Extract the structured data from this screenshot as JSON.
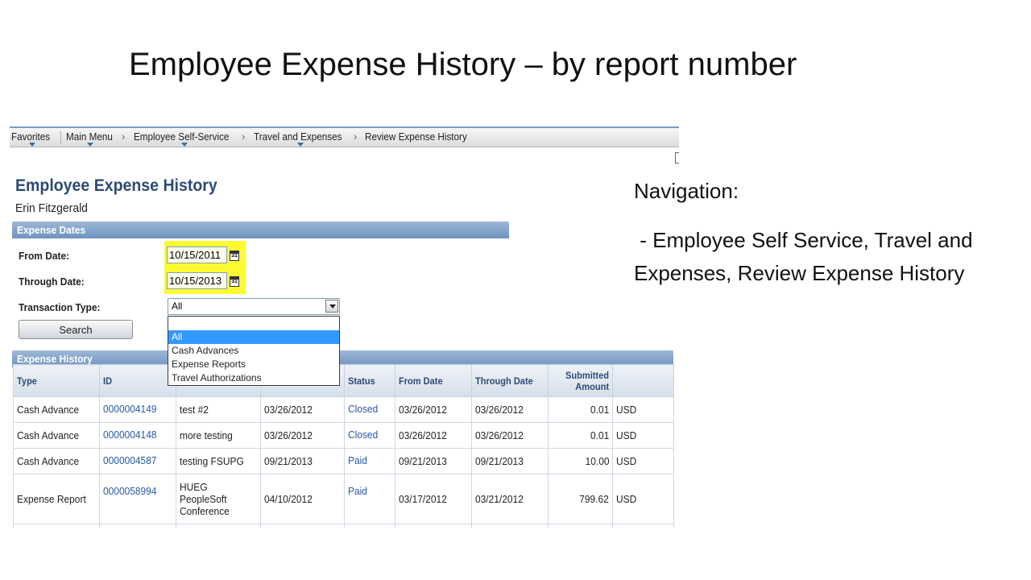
{
  "slide": {
    "title": "Employee Expense History – by report number",
    "navigation_heading": "Navigation:",
    "navigation_text": " - Employee Self Service, Travel and Expenses, Review Expense History"
  },
  "breadcrumb": {
    "items": [
      "Favorites",
      "Main Menu",
      "Employee Self-Service",
      "Travel and Expenses",
      "Review Expense History"
    ]
  },
  "page": {
    "title": "Employee Expense History",
    "employee_name": "Erin Fitzgerald"
  },
  "expense_dates": {
    "header": "Expense Dates",
    "from_label": "From Date:",
    "from_value": "10/15/2011",
    "through_label": "Through Date:",
    "through_value": "10/15/2013",
    "type_label": "Transaction Type:",
    "type_value": "All",
    "type_options": [
      "All",
      "Cash Advances",
      "Expense Reports",
      "Travel Authorizations"
    ],
    "search_label": "Search"
  },
  "expense_history": {
    "header": "Expense History",
    "columns": [
      "Type",
      "ID",
      "",
      "",
      "Status",
      "From Date",
      "Through Date",
      "Submitted Amount",
      ""
    ],
    "rows": [
      {
        "type": "Cash Advance",
        "id": "0000004149",
        "description": "test #2",
        "date": "03/26/2012",
        "status": "Closed",
        "from": "03/26/2012",
        "through": "03/26/2012",
        "amount": "0.01",
        "currency": "USD"
      },
      {
        "type": "Cash Advance",
        "id": "0000004148",
        "description": "more testing",
        "date": "03/26/2012",
        "status": "Closed",
        "from": "03/26/2012",
        "through": "03/26/2012",
        "amount": "0.01",
        "currency": "USD"
      },
      {
        "type": "Cash Advance",
        "id": "0000004587",
        "description": "testing FSUPG",
        "date": "09/21/2013",
        "status": "Paid",
        "from": "09/21/2013",
        "through": "09/21/2013",
        "amount": "10.00",
        "currency": "USD"
      },
      {
        "type": "Expense Report",
        "id": "0000058994",
        "description_lines": [
          "HUEG",
          "PeopleSoft",
          "Conference"
        ],
        "date": "04/10/2012",
        "status": "Paid",
        "from": "03/17/2012",
        "through": "03/21/2012",
        "amount": "799.62",
        "currency": "USD"
      }
    ]
  },
  "colors": {
    "section_header": "#7a9bc6",
    "highlight": "#fbfb33",
    "link": "#2858a8",
    "dropdown_selected": "#3399ff",
    "page_title": "#2e4b74"
  }
}
